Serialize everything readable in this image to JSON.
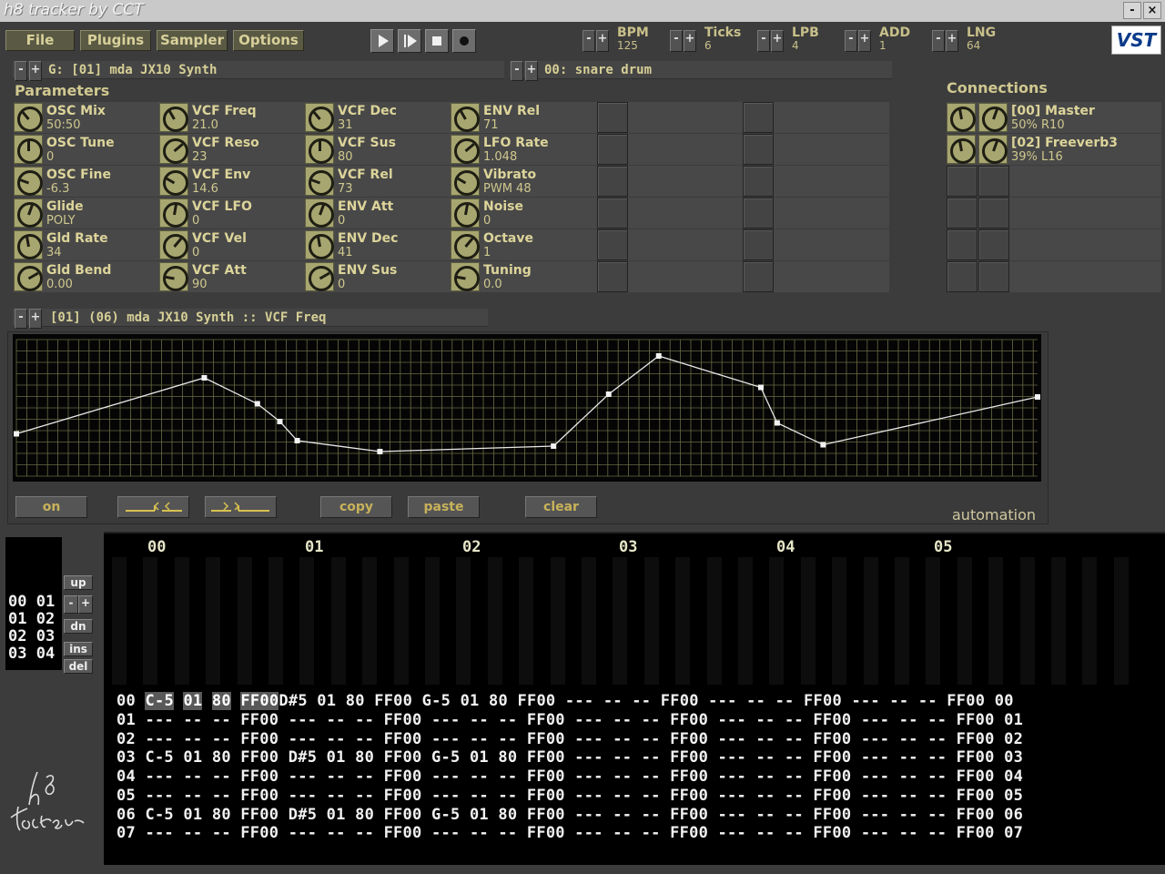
{
  "window": {
    "title": "h8 tracker by CCT",
    "min_label": "-",
    "close_label": "×"
  },
  "menu": [
    {
      "label": "File"
    },
    {
      "label": "Plugins"
    },
    {
      "label": "Sampler"
    },
    {
      "label": "Options"
    }
  ],
  "transport": [
    "play-icon",
    "play-pattern-icon",
    "stop-icon",
    "record-icon"
  ],
  "settings": [
    {
      "label": "BPM",
      "value": "125"
    },
    {
      "label": "Ticks",
      "value": "6"
    },
    {
      "label": "LPB",
      "value": "4"
    },
    {
      "label": "ADD",
      "value": "1"
    },
    {
      "label": "LNG",
      "value": "64"
    }
  ],
  "vst_logo": "VST",
  "generator_bar": "G: [01] mda JX10 Synth",
  "sample_bar": "00: snare drum",
  "params_title": "Parameters",
  "connections_title": "Connections",
  "params": [
    [
      {
        "name": "OSC Mix",
        "value": "50:50"
      },
      {
        "name": "OSC Tune",
        "value": "0"
      },
      {
        "name": "OSC Fine",
        "value": "-6.3"
      },
      {
        "name": "Glide",
        "value": "POLY"
      },
      {
        "name": "Gld Rate",
        "value": "34"
      },
      {
        "name": "Gld Bend",
        "value": "0.00"
      }
    ],
    [
      {
        "name": "VCF Freq",
        "value": "21.0"
      },
      {
        "name": "VCF Reso",
        "value": "23"
      },
      {
        "name": "VCF Env",
        "value": "14.6"
      },
      {
        "name": "VCF LFO",
        "value": "0"
      },
      {
        "name": "VCF Vel",
        "value": "0"
      },
      {
        "name": "VCF Att",
        "value": "90"
      }
    ],
    [
      {
        "name": "VCF Dec",
        "value": "31"
      },
      {
        "name": "VCF Sus",
        "value": "80"
      },
      {
        "name": "VCF Rel",
        "value": "73"
      },
      {
        "name": "ENV Att",
        "value": "0"
      },
      {
        "name": "ENV Dec",
        "value": "41"
      },
      {
        "name": "ENV Sus",
        "value": "0"
      }
    ],
    [
      {
        "name": "ENV Rel",
        "value": "71"
      },
      {
        "name": "LFO Rate",
        "value": "1.048"
      },
      {
        "name": "Vibrato",
        "value": "PWM  48"
      },
      {
        "name": "Noise",
        "value": "0"
      },
      {
        "name": "Octave",
        "value": "1"
      },
      {
        "name": "Tuning",
        "value": "0.0"
      }
    ]
  ],
  "connections": [
    {
      "name": "[00] Master",
      "value": "50%  R10"
    },
    {
      "name": "[02] Freeverb3",
      "value": "39%  L16"
    }
  ],
  "automation_bar": "[01] (06) mda JX10 Synth :: VCF Freq",
  "automation_points": [
    [
      0,
      0.31
    ],
    [
      0.184,
      0.72
    ],
    [
      0.236,
      0.53
    ],
    [
      0.258,
      0.4
    ],
    [
      0.275,
      0.26
    ],
    [
      0.356,
      0.18
    ],
    [
      0.526,
      0.22
    ],
    [
      0.58,
      0.6
    ],
    [
      0.629,
      0.88
    ],
    [
      0.729,
      0.65
    ],
    [
      0.745,
      0.39
    ],
    [
      0.79,
      0.23
    ],
    [
      1.0,
      0.58
    ]
  ],
  "automation_buttons": {
    "on": "on",
    "copy": "copy",
    "paste": "paste",
    "clear": "clear"
  },
  "automation_label": "automation",
  "order": {
    "lines": [
      "00 01",
      "01 02",
      "02 03",
      "03 04"
    ],
    "up": "up",
    "minus": "-",
    "plus": "+",
    "dn": "dn",
    "ins": "ins",
    "del": "del"
  },
  "pattern_headers": [
    "00",
    "01",
    "02",
    "03",
    "04",
    "05"
  ],
  "pattern_rows": [
    "00 C-5 01 80 FF00 D#5 01 80 FF00 G-5 01 80 FF00 --- -- -- FF00 --- -- -- FF00 --- -- -- FF00 00",
    "01 --- -- -- FF00 --- -- -- FF00 --- -- -- FF00 --- -- -- FF00 --- -- -- FF00 --- -- -- FF00 01",
    "02 --- -- -- FF00 --- -- -- FF00 --- -- -- FF00 --- -- -- FF00 --- -- -- FF00 --- -- -- FF00 02",
    "03 C-5 01 80 FF00 D#5 01 80 FF00 G-5 01 80 FF00 --- -- -- FF00 --- -- -- FF00 --- -- -- FF00 03",
    "04 --- -- -- FF00 --- -- -- FF00 --- -- -- FF00 --- -- -- FF00 --- -- -- FF00 --- -- -- FF00 04",
    "05 --- -- -- FF00 --- -- -- FF00 --- -- -- FF00 --- -- -- FF00 --- -- -- FF00 --- -- -- FF00 05",
    "06 C-5 01 80 FF00 D#5 01 80 FF00 G-5 01 80 FF00 --- -- -- FF00 --- -- -- FF00 --- -- -- FF00 06",
    "07 --- -- -- FF00 --- -- -- FF00 --- -- -- FF00 --- -- -- FF00 --- -- -- FF00 --- -- -- FF00 07"
  ],
  "cursor_row": {
    "num": "00 ",
    "note": "C-5",
    "sp1": " ",
    "inst": "01",
    "sp2": " ",
    "vol": "80",
    "sp3": " ",
    "fx": "FF00",
    "rest": "D#5 01 80 FF00 G-5 01 80 FF00 --- -- -- FF00 --- -- -- FF00 --- -- -- FF00 00"
  },
  "logo_text": "h8 tracker"
}
